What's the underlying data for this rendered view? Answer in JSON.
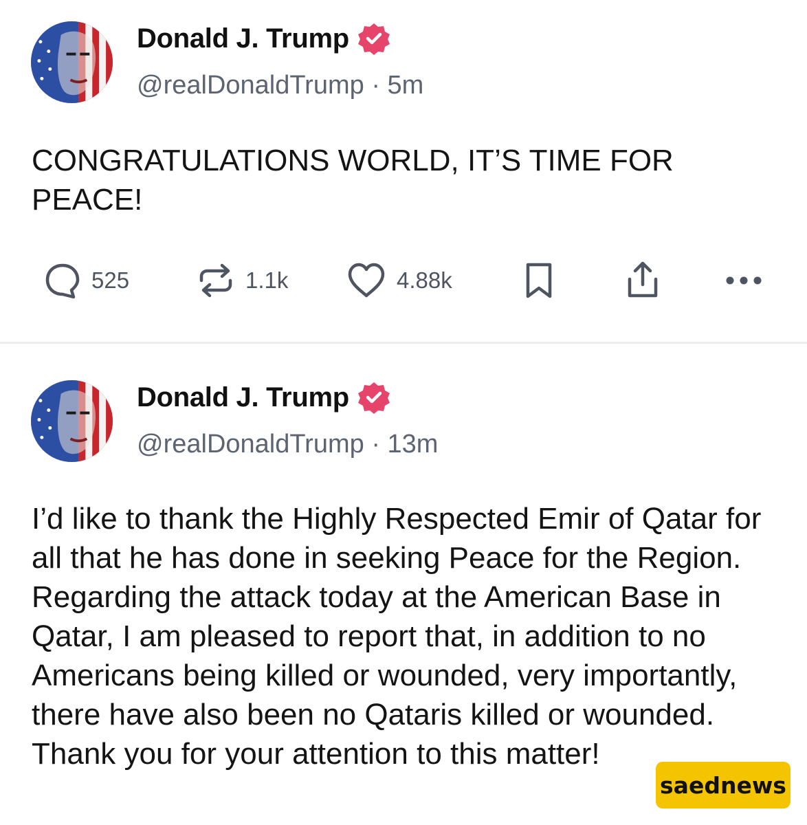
{
  "posts": [
    {
      "author_name": "Donald J. Trump",
      "handle": "@realDonaldTrump",
      "separator": "·",
      "time": "5m",
      "avatar_icon": "flag-portrait-avatar",
      "verified_icon": "verified-badge-icon",
      "verified_color": "#e6446b",
      "text": "CONGRATULATIONS WORLD, IT’S TIME FOR PEACE!",
      "actions": {
        "replies": "525",
        "reposts": "1.1k",
        "likes": "4.88k"
      }
    },
    {
      "author_name": "Donald J. Trump",
      "handle": "@realDonaldTrump",
      "separator": "·",
      "time": "13m",
      "avatar_icon": "flag-portrait-avatar",
      "verified_icon": "verified-badge-icon",
      "verified_color": "#e6446b",
      "text": "I’d like to thank the Highly Respected Emir of Qatar for all that he has done in seeking Peace for the Region. Regarding the attack today at the American Base in Qatar, I am pleased to report that, in addition to no Americans being killed or wounded, very importantly, there have also been no Qataris killed or wounded. Thank you for your attention to this matter!"
    }
  ],
  "action_icons": [
    "reply-icon",
    "repost-icon",
    "like-icon",
    "bookmark-icon",
    "share-icon",
    "more-icon"
  ],
  "watermark": {
    "text": "saednews",
    "color": "#f5c400"
  }
}
